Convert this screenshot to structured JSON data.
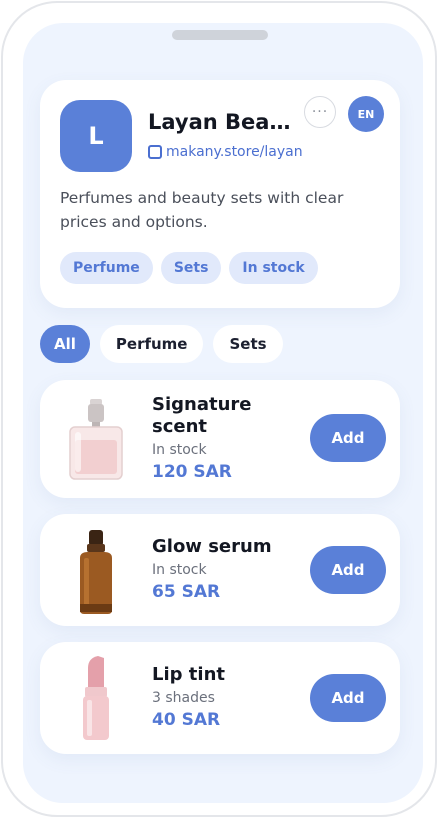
{
  "store": {
    "avatar_letter": "L",
    "name": "Layan Beauty",
    "url": "makany.store/layan",
    "description": "Perfumes and beauty sets with clear prices and options.",
    "tags": [
      "Perfume",
      "Sets",
      "In stock"
    ],
    "more_label": "···",
    "lang_label": "EN"
  },
  "filters": {
    "items": [
      "All",
      "Perfume",
      "Sets"
    ],
    "selected": "All"
  },
  "products": [
    {
      "name": "Signature scent",
      "meta": "In stock",
      "price": "120 SAR",
      "action": "Add",
      "image": "perfume-bottle-icon"
    },
    {
      "name": "Glow serum",
      "meta": "In stock",
      "price": "65 SAR",
      "action": "Add",
      "image": "serum-bottle-icon"
    },
    {
      "name": "Lip tint",
      "meta": "3 shades",
      "price": "40 SAR",
      "action": "Add",
      "image": "lipstick-icon"
    }
  ],
  "colors": {
    "accent": "#5a80d8",
    "background": "#eef4fe",
    "tag_bg": "#e1e9fb",
    "price": "#5378d4"
  }
}
